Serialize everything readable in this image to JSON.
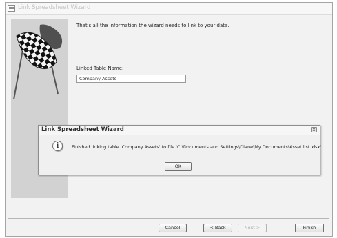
{
  "wizard": {
    "title": "Link Spreadsheet Wizard",
    "info_text": "That's all the information the wizard needs to link to your data.",
    "linked_table_label": "Linked Table Name:",
    "linked_table_value": "Company Assets",
    "buttons": {
      "cancel": "Cancel",
      "back": "< Back",
      "next": "Next >",
      "finish": "Finish"
    }
  },
  "dialog": {
    "title": "Link Spreadsheet Wizard",
    "icon": "info-icon",
    "icon_glyph": "i",
    "message": "Finished linking table 'Company Assets' to file 'C:\\Documents and Settings\\Diane\\My Documents\\Asset list.xlsx'.",
    "ok_label": "OK",
    "close_glyph": "x"
  }
}
